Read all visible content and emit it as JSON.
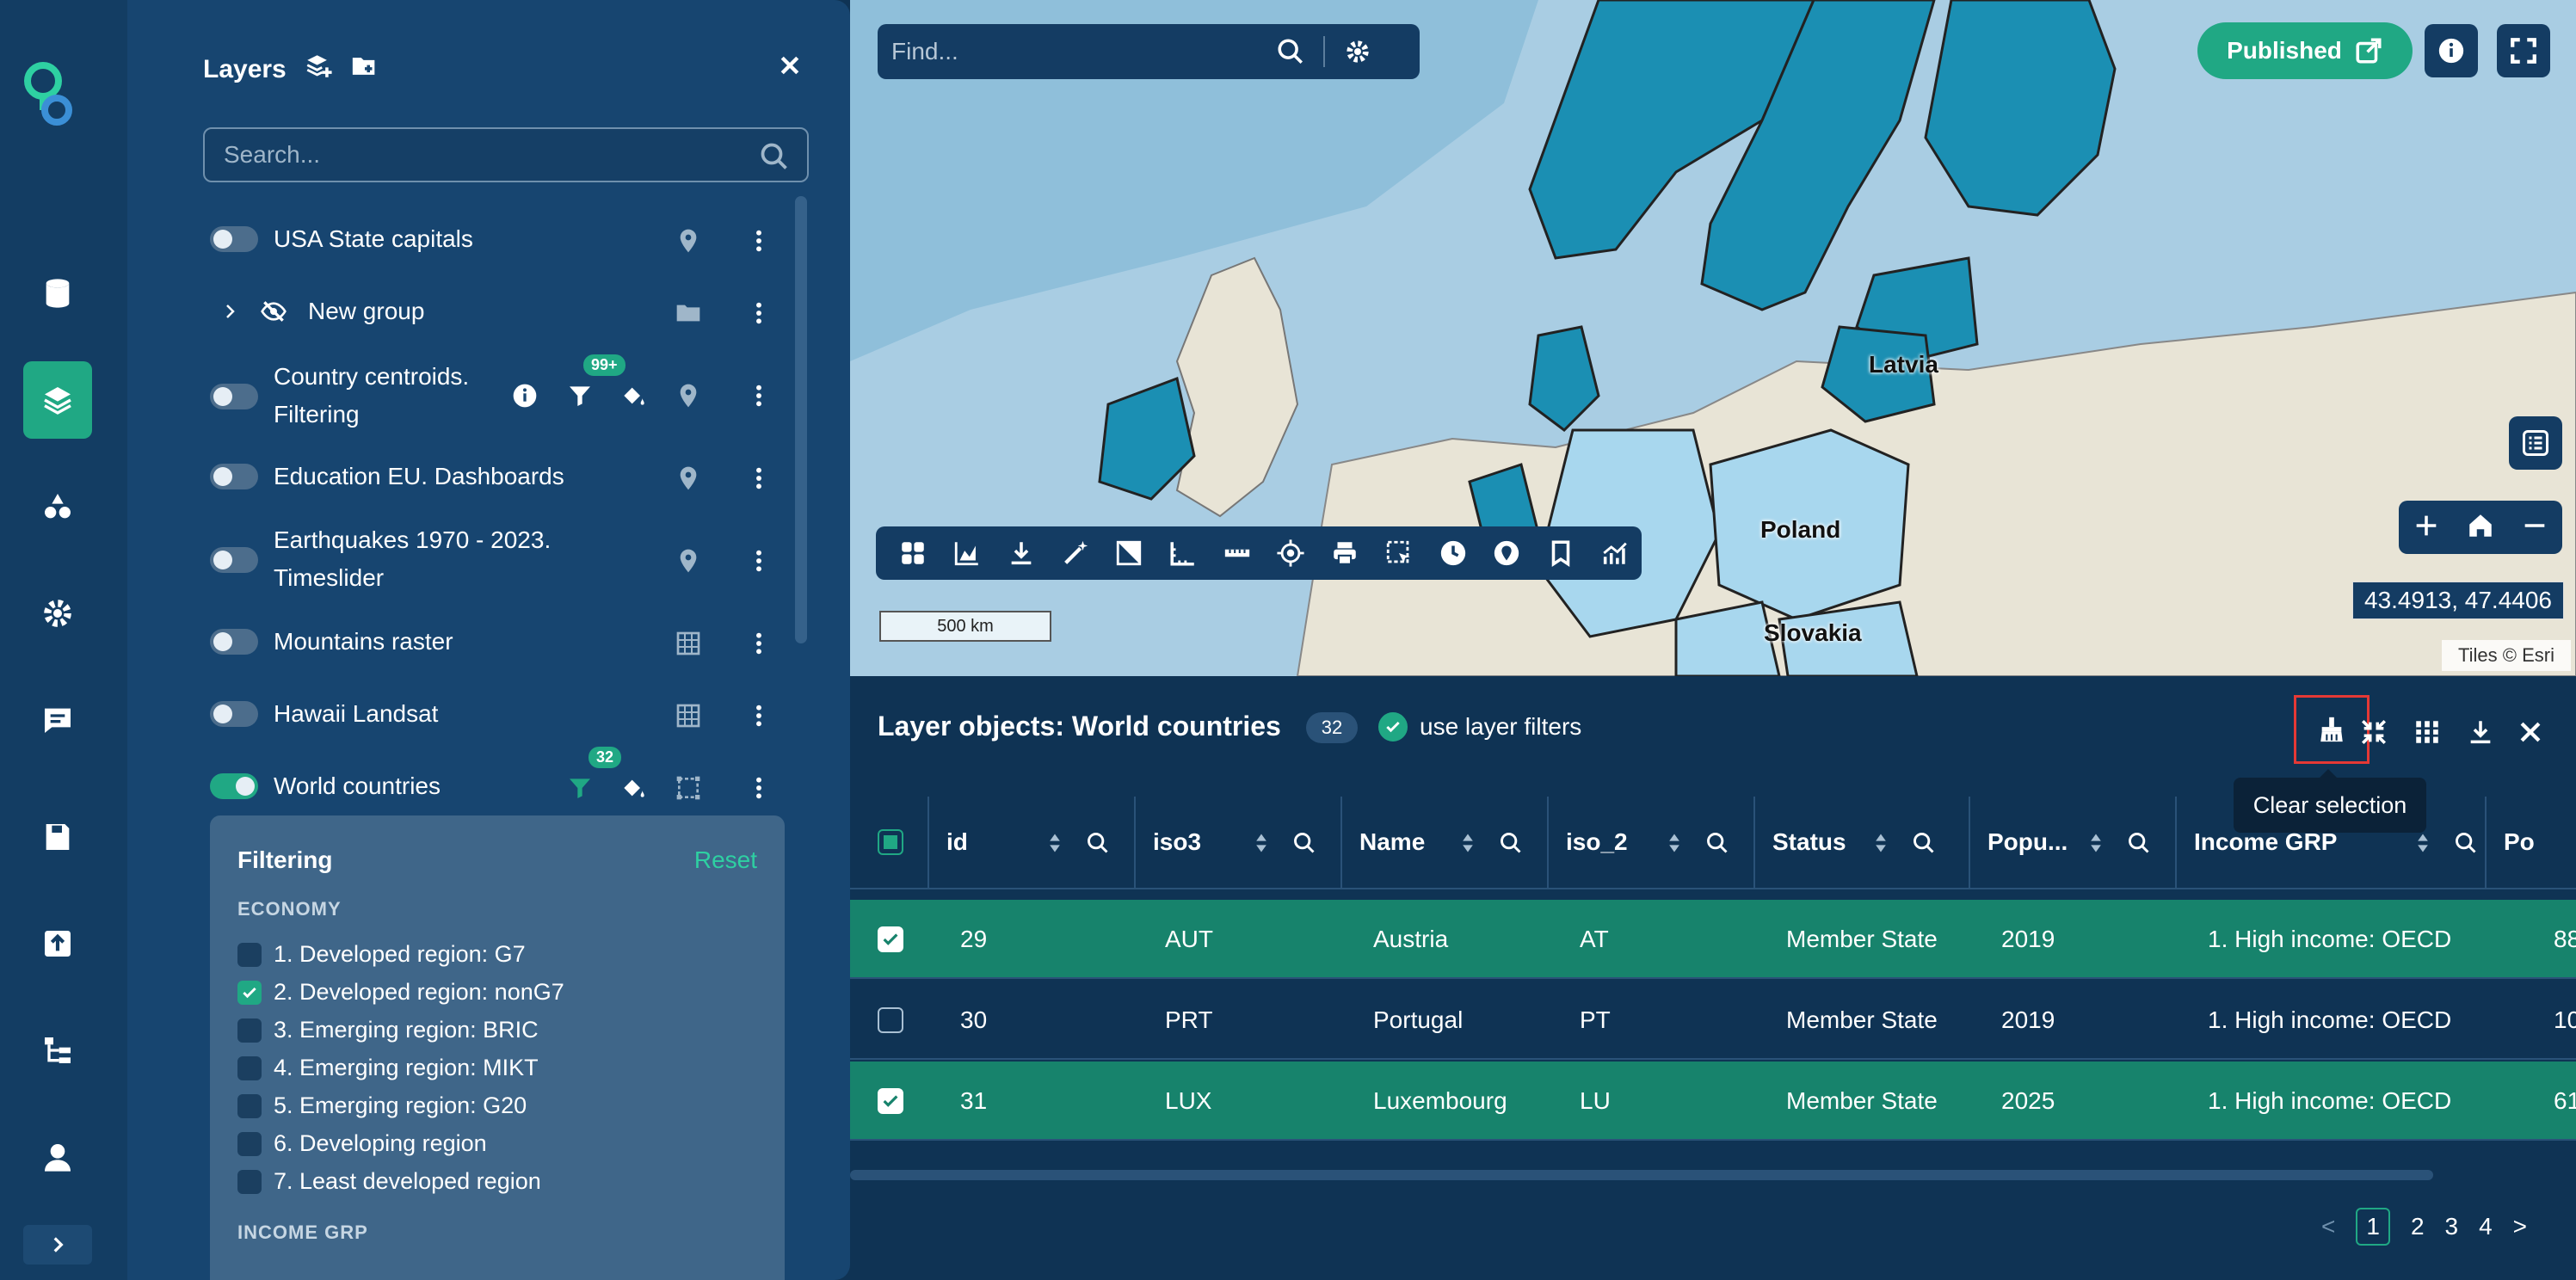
{
  "rail": {
    "items": [
      {
        "name": "database-icon"
      },
      {
        "name": "layers-icon",
        "active": true
      },
      {
        "name": "shapes-icon"
      },
      {
        "name": "gear-icon"
      },
      {
        "name": "comment-icon"
      },
      {
        "name": "save-icon"
      },
      {
        "name": "upload-icon"
      },
      {
        "name": "tree-icon"
      },
      {
        "name": "user-icon"
      }
    ]
  },
  "layers_panel": {
    "title": "Layers",
    "search_placeholder": "Search...",
    "layers": [
      {
        "label": "USA State capitals",
        "on": false
      },
      {
        "label": "New group",
        "group": true
      },
      {
        "label": "Country centroids. Filtering",
        "on": false,
        "filter_badge": "99+"
      },
      {
        "label": "Education EU. Dashboards",
        "on": false
      },
      {
        "label": "Earthquakes 1970 - 2023. Timeslider",
        "on": false
      },
      {
        "label": "Mountains raster",
        "on": false
      },
      {
        "label": "Hawaii Landsat",
        "on": false
      },
      {
        "label": "World countries",
        "on": true,
        "filter_badge": "32"
      }
    ],
    "filtering": {
      "title": "Filtering",
      "reset_label": "Reset",
      "section": "ECONOMY",
      "options": [
        {
          "label": "1. Developed region: G7",
          "checked": false
        },
        {
          "label": "2. Developed region: nonG7",
          "checked": true
        },
        {
          "label": "3. Emerging region: BRIC",
          "checked": false
        },
        {
          "label": "4. Emerging region: MIKT",
          "checked": false
        },
        {
          "label": "5. Emerging region: G20",
          "checked": false
        },
        {
          "label": "6. Developing region",
          "checked": false
        },
        {
          "label": "7. Least developed region",
          "checked": false
        }
      ],
      "next_section": "INCOME GRP"
    }
  },
  "map": {
    "find_placeholder": "Find...",
    "published_label": "Published",
    "scale_label": "500 km",
    "coords": "43.4913, 47.4406",
    "attribution": "Tiles © Esri",
    "labels": [
      "Latvia",
      "Poland",
      "Slovakia"
    ],
    "colors": {
      "sea": "#a9cde3",
      "land": "#e8e4d6",
      "selected_dark": "#1b8fb3",
      "selected_light": "#a8d7ee"
    }
  },
  "table": {
    "title": "Layer objects: World countries",
    "count": "32",
    "use_filters_label": "use layer filters",
    "tooltip": "Clear selection",
    "columns": [
      "id",
      "iso3",
      "Name",
      "iso_2",
      "Status",
      "Popu...",
      "Income GRP",
      "Po"
    ],
    "rows": [
      {
        "selected": true,
        "cells": [
          "29",
          "AUT",
          "Austria",
          "AT",
          "Member State",
          "2019",
          "1. High income: OECD",
          "88"
        ]
      },
      {
        "selected": false,
        "cells": [
          "30",
          "PRT",
          "Portugal",
          "PT",
          "Member State",
          "2019",
          "1. High income: OECD",
          "10"
        ]
      },
      {
        "selected": true,
        "cells": [
          "31",
          "LUX",
          "Luxembourg",
          "LU",
          "Member State",
          "2025",
          "1. High income: OECD",
          "61"
        ]
      }
    ],
    "pager": {
      "prev": "<",
      "pages": [
        "1",
        "2",
        "3",
        "4"
      ],
      "next": ">"
    }
  },
  "accent": "#20a884"
}
